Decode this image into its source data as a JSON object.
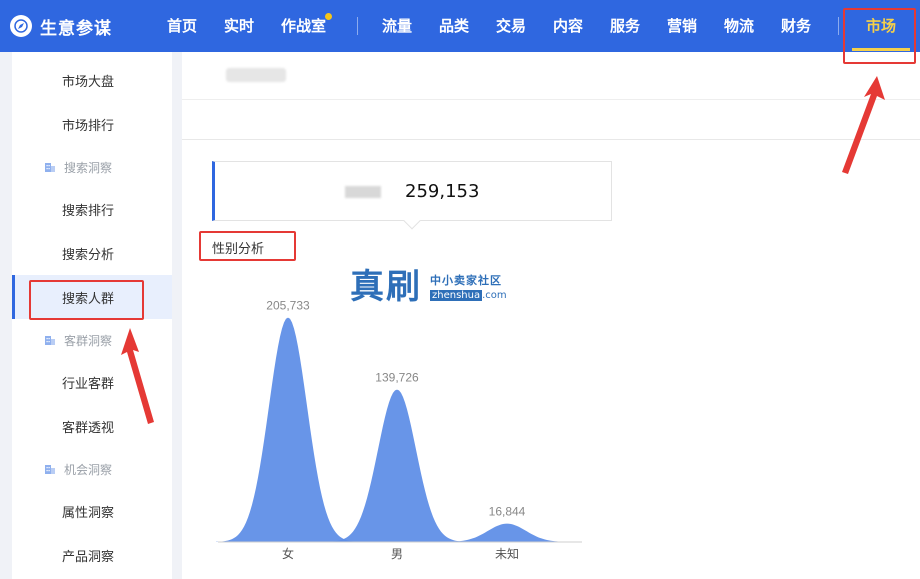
{
  "app": {
    "title": "生意参谋"
  },
  "nav": {
    "items": [
      {
        "label": "首页"
      },
      {
        "label": "实时"
      },
      {
        "label": "作战室"
      },
      {
        "label": "流量"
      },
      {
        "label": "品类"
      },
      {
        "label": "交易"
      },
      {
        "label": "内容"
      },
      {
        "label": "服务"
      },
      {
        "label": "营销"
      },
      {
        "label": "物流"
      },
      {
        "label": "财务"
      },
      {
        "label": "市场",
        "active": true
      }
    ],
    "accent_color": "#f5d04a",
    "bar_color": "#2f67e0"
  },
  "sidebar": {
    "items": [
      {
        "label": "市场大盘"
      },
      {
        "label": "市场排行"
      },
      {
        "group": "搜索洞察"
      },
      {
        "label": "搜索排行"
      },
      {
        "label": "搜索分析"
      },
      {
        "label": "搜索人群",
        "active": true
      },
      {
        "group": "客群洞察"
      },
      {
        "label": "行业客群"
      },
      {
        "label": "客群透视"
      },
      {
        "group": "机会洞察"
      },
      {
        "label": "属性洞察"
      },
      {
        "label": "产品洞察"
      }
    ]
  },
  "summary": {
    "value": "259,153"
  },
  "section": {
    "title": "性别分析"
  },
  "watermark": {
    "big": "真刷",
    "small": "中小卖家社区",
    "url_tag": "zhenshua",
    "url_rest": ".com"
  },
  "chart_data": {
    "type": "area",
    "categories": [
      "女",
      "男",
      "未知"
    ],
    "values": [
      205733,
      139726,
      16844
    ],
    "data_labels": [
      "205,733",
      "139,726",
      "16,844"
    ],
    "ylim": [
      0,
      220000
    ],
    "grid": false,
    "color": "#5b8ce6"
  },
  "annotations": {
    "highlight_color": "#e53935"
  }
}
